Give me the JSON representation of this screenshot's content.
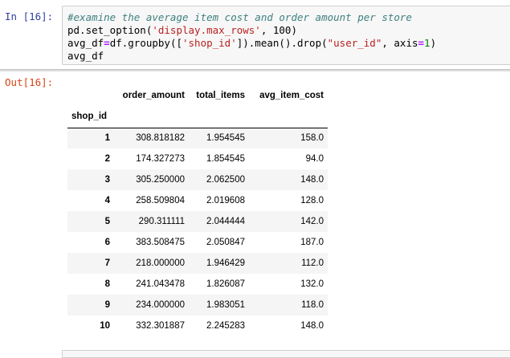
{
  "input_cell": {
    "prompt": "In [16]:",
    "code_lines": [
      [
        {
          "t": "#examine the average item cost and order amount per store",
          "c": "cm"
        }
      ],
      [
        {
          "t": "pd.set_option(",
          "c": ""
        },
        {
          "t": "'display.max_rows'",
          "c": "st"
        },
        {
          "t": ", 100)",
          "c": ""
        }
      ],
      [
        {
          "t": "avg_df",
          "c": ""
        },
        {
          "t": "=",
          "c": "op"
        },
        {
          "t": "df.groupby([",
          "c": ""
        },
        {
          "t": "'shop_id'",
          "c": "st"
        },
        {
          "t": "]).mean().drop(",
          "c": ""
        },
        {
          "t": "\"user_id\"",
          "c": "st"
        },
        {
          "t": ", axis",
          "c": ""
        },
        {
          "t": "=",
          "c": "op"
        },
        {
          "t": "1",
          "c": "nm"
        },
        {
          "t": ")",
          "c": ""
        }
      ],
      [
        {
          "t": "avg_df",
          "c": ""
        }
      ]
    ]
  },
  "output_cell": {
    "prompt": "Out[16]:",
    "table": {
      "columns": [
        "order_amount",
        "total_items",
        "avg_item_cost"
      ],
      "index_name": "shop_id",
      "rows": [
        {
          "index": "1",
          "values": [
            "308.818182",
            "1.954545",
            "158.0"
          ]
        },
        {
          "index": "2",
          "values": [
            "174.327273",
            "1.854545",
            "94.0"
          ]
        },
        {
          "index": "3",
          "values": [
            "305.250000",
            "2.062500",
            "148.0"
          ]
        },
        {
          "index": "4",
          "values": [
            "258.509804",
            "2.019608",
            "128.0"
          ]
        },
        {
          "index": "5",
          "values": [
            "290.311111",
            "2.044444",
            "142.0"
          ]
        },
        {
          "index": "6",
          "values": [
            "383.508475",
            "2.050847",
            "187.0"
          ]
        },
        {
          "index": "7",
          "values": [
            "218.000000",
            "1.946429",
            "112.0"
          ]
        },
        {
          "index": "8",
          "values": [
            "241.043478",
            "1.826087",
            "132.0"
          ]
        },
        {
          "index": "9",
          "values": [
            "234.000000",
            "1.983051",
            "118.0"
          ]
        },
        {
          "index": "10",
          "values": [
            "332.301887",
            "2.245283",
            "148.0"
          ]
        }
      ]
    }
  }
}
